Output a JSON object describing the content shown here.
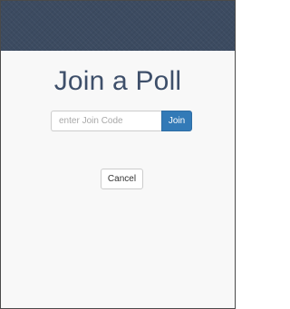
{
  "header": {
    "background_color": "#3c4b61"
  },
  "main": {
    "title": "Join a Poll",
    "join_code_input": {
      "value": "",
      "placeholder": "enter Join Code"
    },
    "join_button_label": "Join",
    "cancel_button_label": "Cancel"
  },
  "colors": {
    "title_text": "#3e4f6a",
    "primary_button": "#337ab7",
    "page_background": "#f8f8f8"
  }
}
